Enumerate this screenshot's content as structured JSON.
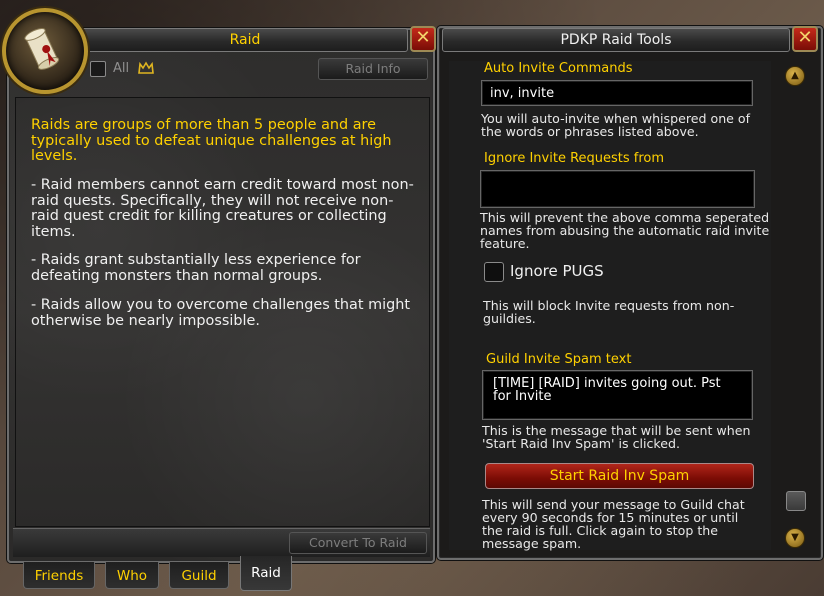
{
  "raid": {
    "title": "Raid",
    "close_label": "✕",
    "all_label": "All",
    "raid_info_label": "Raid Info",
    "heading": "Raids are groups of more than 5 people and are typically used to defeat unique challenges at high levels.",
    "paragraphs": [
      "- Raid members cannot earn credit toward most non-raid quests. Specifically, they will not receive non-raid quest credit for killing creatures or collecting items.",
      "- Raids grant substantially less experience for defeating monsters than normal groups.",
      "- Raids allow you to overcome challenges that might otherwise be nearly impossible."
    ],
    "convert_label": "Convert To Raid"
  },
  "tabs": [
    {
      "label": "Friends",
      "active": false
    },
    {
      "label": "Who",
      "active": false
    },
    {
      "label": "Guild",
      "active": false
    },
    {
      "label": "Raid",
      "active": true
    }
  ],
  "pdkp": {
    "title": "PDKP Raid Tools",
    "close_label": "✕",
    "auto_invite": {
      "label": "Auto Invite Commands",
      "value": "inv, invite",
      "help": "You will auto-invite when whispered one of the words or phrases listed above."
    },
    "ignore_invite": {
      "label": "Ignore Invite Requests from",
      "value": "",
      "help": "This will prevent the above comma seperated names from abusing the automatic raid invite feature."
    },
    "ignore_pugs": {
      "label": "Ignore PUGS",
      "checked": false,
      "help": "This will block Invite requests from non-guildies."
    },
    "spam_text": {
      "label": "Guild Invite Spam text",
      "value": "[TIME] [RAID] invites going out. Pst for Invite",
      "help": "This is the message that will be sent when 'Start Raid Inv Spam' is clicked."
    },
    "spam_button_label": "Start Raid Inv Spam",
    "spam_help": "This will send your message to Guild chat every 90 seconds for 15 minutes or until the raid is full. Click again to stop the message spam."
  },
  "colors": {
    "gold": "#ffd100",
    "close_red": "#c42a1a"
  }
}
